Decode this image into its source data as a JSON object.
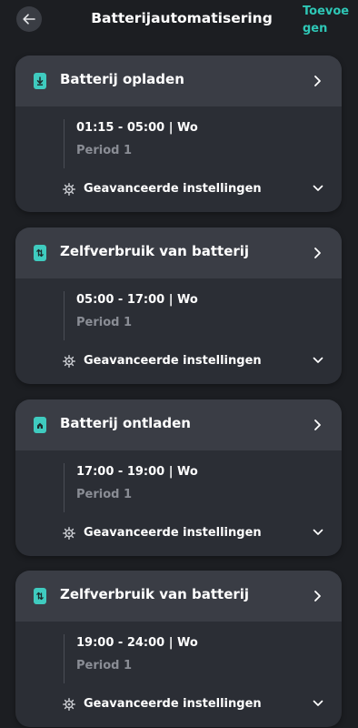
{
  "header": {
    "title": "Batterijautomatisering",
    "add_label": "Toevoegen",
    "back_icon": "arrow-left-icon"
  },
  "colors": {
    "background": "#1c1e22",
    "card": "#2b2e35",
    "card_header": "#3a3d45",
    "accent": "#2ec7b6",
    "muted_text": "#8a8d95"
  },
  "cards": [
    {
      "title": "Batterij opladen",
      "icon": "battery-charge-icon",
      "time": "01:15 - 05:00 | Wo",
      "period": "Period 1",
      "advanced_label": "Geavanceerde instellingen"
    },
    {
      "title": "Zelfverbruik van batterij",
      "icon": "battery-self-use-icon",
      "time": "05:00 - 17:00 | Wo",
      "period": "Period 1",
      "advanced_label": "Geavanceerde instellingen"
    },
    {
      "title": "Batterij ontladen",
      "icon": "battery-discharge-icon",
      "time": "17:00 - 19:00 | Wo",
      "period": "Period 1",
      "advanced_label": "Geavanceerde instellingen"
    },
    {
      "title": "Zelfverbruik van batterij",
      "icon": "battery-self-use-icon",
      "time": "19:00 - 24:00 | Wo",
      "period": "Period 1",
      "advanced_label": "Geavanceerde instellingen"
    }
  ]
}
